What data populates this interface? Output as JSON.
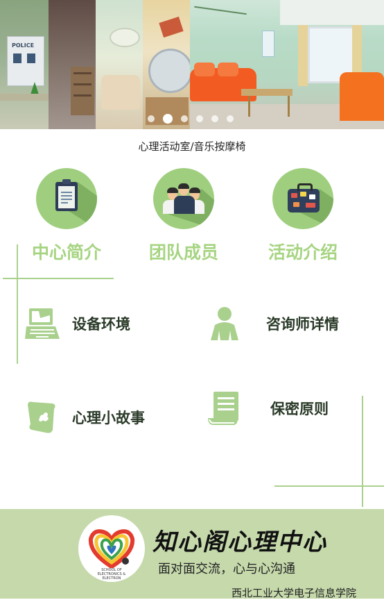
{
  "banner": {
    "caption": "心理活动室/音乐按摩椅",
    "slide_count": 6,
    "active_slide": 2,
    "police_sign": "POLICE"
  },
  "features": [
    {
      "label": "中心简介",
      "icon": "clipboard-icon"
    },
    {
      "label": "团队成员",
      "icon": "team-icon"
    },
    {
      "label": "活动介绍",
      "icon": "suitcase-icon"
    }
  ],
  "menu": [
    {
      "label": "设备环境",
      "icon": "laptop-icon"
    },
    {
      "label": "咨询师详情",
      "icon": "person-icon"
    },
    {
      "label": "心理小故事",
      "icon": "scroll-icon"
    },
    {
      "label": "保密原则",
      "icon": "document-icon"
    }
  ],
  "footer": {
    "brand": "知心阁心理中心",
    "slogan": "面对面交流，心与心沟通",
    "school": "西北工业大学电子信息学院",
    "logo_text": "SCHOOL OF ELECTRONICS & ELECTRON"
  },
  "colors": {
    "accent_green": "#9fcf7e",
    "label_green": "#a6d481",
    "footer_bg": "#c5d9ab",
    "line_green": "#a9d18d"
  }
}
